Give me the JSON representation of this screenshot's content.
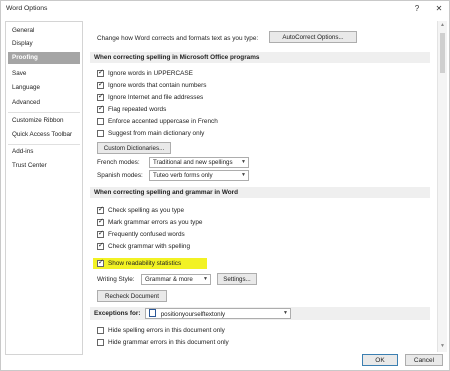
{
  "window": {
    "title": "Word Options",
    "help_label": "?",
    "close_label": "✕"
  },
  "sidebar": {
    "items": [
      {
        "label": "General"
      },
      {
        "label": "Display"
      },
      {
        "label": "Proofing"
      },
      {
        "label": "Save"
      },
      {
        "label": "Language"
      },
      {
        "label": "Advanced"
      },
      {
        "label": "Customize Ribbon"
      },
      {
        "label": "Quick Access Toolbar"
      },
      {
        "label": "Add-ins"
      },
      {
        "label": "Trust Center"
      }
    ],
    "selected": "Proofing"
  },
  "autocorrect": {
    "text": "Change how Word corrects and formats text as you type:",
    "button_label": "AutoCorrect Options..."
  },
  "office_section": {
    "header": "When correcting spelling in Microsoft Office programs",
    "checkboxes": [
      {
        "label": "Ignore words in UPPERCASE",
        "checked": true
      },
      {
        "label": "Ignore words that contain numbers",
        "checked": true
      },
      {
        "label": "Ignore Internet and file addresses",
        "checked": true
      },
      {
        "label": "Flag repeated words",
        "checked": true
      },
      {
        "label": "Enforce accented uppercase in French",
        "checked": false
      },
      {
        "label": "Suggest from main dictionary only",
        "checked": false
      }
    ],
    "custom_dict_label": "Custom Dictionaries...",
    "french_modes_label": "French modes:",
    "french_modes_value": "Traditional and new spellings",
    "spanish_modes_label": "Spanish modes:",
    "spanish_modes_value": "Tuteo verb forms only"
  },
  "word_section": {
    "header": "When correcting spelling and grammar in Word",
    "checkboxes": [
      {
        "label": "Check spelling as you type",
        "checked": true
      },
      {
        "label": "Mark grammar errors as you type",
        "checked": true
      },
      {
        "label": "Frequently confused words",
        "checked": true
      },
      {
        "label": "Check grammar with spelling",
        "checked": true
      },
      {
        "label": "Show readability statistics",
        "checked": true
      }
    ],
    "writing_style_label": "Writing Style:",
    "writing_style_value": "Grammar & more",
    "settings_label": "Settings...",
    "recheck_label": "Recheck Document"
  },
  "exceptions": {
    "label": "Exceptions for:",
    "document": "positionyourselftextonly",
    "checkboxes": [
      {
        "label": "Hide spelling errors in this document only",
        "checked": false
      },
      {
        "label": "Hide grammar errors in this document only",
        "checked": false
      }
    ]
  },
  "footer": {
    "ok_label": "OK",
    "cancel_label": "Cancel"
  },
  "colors": {
    "highlight": "#f2f224",
    "selected_nav": "#a5a5a5"
  }
}
